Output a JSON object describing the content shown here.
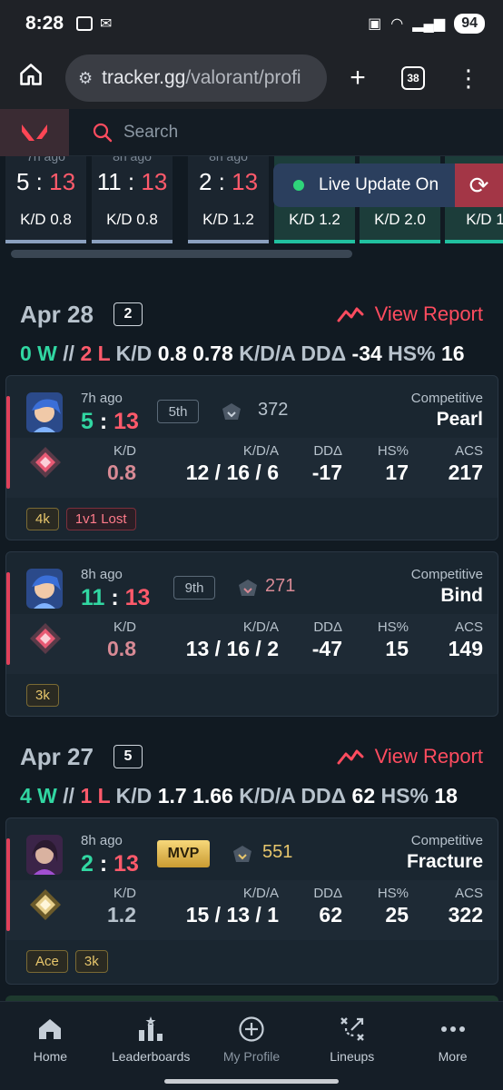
{
  "status_bar": {
    "time": "8:28",
    "battery": "94"
  },
  "browser": {
    "url_main": "tracker.gg",
    "url_path": "/valorant/profi",
    "tab_count": "38"
  },
  "site": {
    "search_placeholder": "Search"
  },
  "recent_strip": [
    {
      "ago": "7h ago",
      "a": "5",
      "b": "13",
      "kd": "K/D 0.8",
      "win": false
    },
    {
      "ago": "8h ago",
      "a": "11",
      "b": "13",
      "kd": "K/D 0.8",
      "win": false
    },
    {
      "ago": "8h ago",
      "a": "2",
      "b": "13",
      "kd": "K/D 1.2",
      "win": false
    },
    {
      "ago": "",
      "a": "",
      "b": "",
      "kd": "K/D 1.2",
      "win": true
    },
    {
      "ago": "",
      "a": "",
      "b": "",
      "kd": "K/D 2.0",
      "win": true
    },
    {
      "ago": "",
      "a": "",
      "b": "",
      "kd": "K/D 1",
      "win": true
    }
  ],
  "live_update": "Live Update On",
  "days": [
    {
      "date": "Apr 28",
      "count": "2",
      "report": "View Report",
      "wins": "0 W",
      "sep": "//",
      "losses": "2 L",
      "kd_label": "K/D",
      "kd": "0.8",
      "kda": "0.78",
      "kda_label": "K/D/A",
      "dd_label": "DDΔ",
      "dd": "-34",
      "hs_label": "HS%",
      "hs": "16"
    },
    {
      "date": "Apr 27",
      "count": "5",
      "report": "View Report",
      "wins": "4 W",
      "sep": "//",
      "losses": "1 L",
      "kd_label": "K/D",
      "kd": "1.7",
      "kda": "1.66",
      "kda_label": "K/D/A",
      "dd_label": "DDΔ",
      "dd": "62",
      "hs_label": "HS%",
      "hs": "18"
    }
  ],
  "matches": [
    {
      "ago": "7h ago",
      "a": "5",
      "b": "13",
      "place": "5th",
      "rr": "372",
      "mode": "Competitive",
      "map": "Pearl",
      "labels": {
        "kd": "K/D",
        "kda": "K/D/A",
        "dd": "DDΔ",
        "hs": "HS%",
        "acs": "ACS"
      },
      "kd": "0.8",
      "kda": "12 / 16 / 6",
      "dd": "-17",
      "hs": "17",
      "acs": "217",
      "tags": [
        "4k",
        "1v1 Lost"
      ]
    },
    {
      "ago": "8h ago",
      "a": "11",
      "b": "13",
      "place": "9th",
      "rr": "271",
      "mode": "Competitive",
      "map": "Bind",
      "labels": {
        "kd": "K/D",
        "kda": "K/D/A",
        "dd": "DDΔ",
        "hs": "HS%",
        "acs": "ACS"
      },
      "kd": "0.8",
      "kda": "13 / 16 / 2",
      "dd": "-47",
      "hs": "15",
      "acs": "149",
      "tags": [
        "3k"
      ]
    },
    {
      "ago": "8h ago",
      "a": "2",
      "b": "13",
      "place": "MVP",
      "rr": "551",
      "mode": "Competitive",
      "map": "Fracture",
      "labels": {
        "kd": "K/D",
        "kda": "K/D/A",
        "dd": "DDΔ",
        "hs": "HS%",
        "acs": "ACS"
      },
      "kd": "1.2",
      "kda": "15 / 13 / 1",
      "dd": "62",
      "hs": "25",
      "acs": "322",
      "tags": [
        "Ace",
        "3k"
      ]
    }
  ],
  "nav": [
    "Home",
    "Leaderboards",
    "My Profile",
    "Lineups",
    "More"
  ],
  "colors": {
    "loss": "#ff5a6b",
    "win": "#31d7a2",
    "accent": "#ff4c5f",
    "bg": "#111a22"
  }
}
